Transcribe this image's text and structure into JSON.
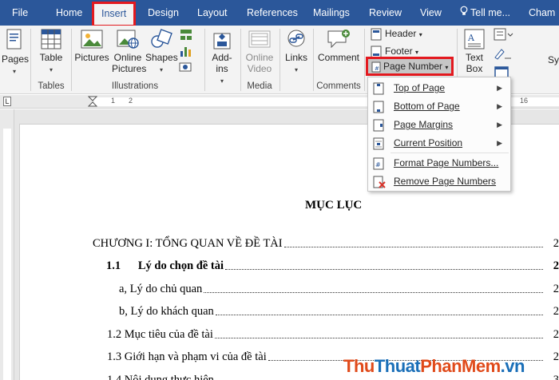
{
  "tabs": [
    {
      "label": "File"
    },
    {
      "label": "Home"
    },
    {
      "label": "Insert",
      "active": true
    },
    {
      "label": "Design"
    },
    {
      "label": "Layout"
    },
    {
      "label": "References"
    },
    {
      "label": "Mailings"
    },
    {
      "label": "Review"
    },
    {
      "label": "View"
    }
  ],
  "tell_me": "Tell me...",
  "user": "Cham",
  "ribbon": {
    "pages": "Pages",
    "table": "Table",
    "pictures": "Pictures",
    "online_pictures": "Online Pictures",
    "shapes": "Shapes",
    "addins": "Add-ins",
    "online_video": "Online Video",
    "links": "Links",
    "comment": "Comment",
    "header": "Header",
    "footer": "Footer",
    "page_number": "Page Number",
    "text_box": "Text Box",
    "sy": "Sy",
    "groups": {
      "tables": "Tables",
      "illustrations": "Illustrations",
      "media": "Media",
      "comments": "Comments"
    }
  },
  "ruler_numbers": [
    "1",
    "2",
    "16"
  ],
  "page_number_menu": [
    {
      "label": "Top of Page",
      "submenu": true,
      "icon": "page-top-icon"
    },
    {
      "label": "Bottom of Page",
      "submenu": true,
      "icon": "page-bottom-icon"
    },
    {
      "label": "Page Margins",
      "submenu": true,
      "icon": "page-margins-icon"
    },
    {
      "label": "Current Position",
      "submenu": true,
      "icon": "current-position-icon"
    },
    {
      "label": "Format Page Numbers...",
      "submenu": false,
      "icon": "format-page-numbers-icon"
    },
    {
      "label": "Remove Page Numbers",
      "submenu": false,
      "icon": "remove-page-numbers-icon"
    }
  ],
  "document": {
    "title": "MỤC LỤC",
    "toc": [
      {
        "text": "CHƯƠNG I: TỔNG QUAN VỀ ĐỀ TÀI",
        "page": "2",
        "bold": false
      },
      {
        "text": "1.1      Lý do chọn đề tài",
        "page": "2",
        "bold": true
      },
      {
        "text": "a, Lý do chủ quan",
        "page": "2",
        "bold": false
      },
      {
        "text": "b, Lý do khách quan",
        "page": "2",
        "bold": false
      },
      {
        "text": "1.2 Mục tiêu của đề tài",
        "page": "2",
        "bold": false
      },
      {
        "text": "1.3 Giới hạn và phạm vi của đề tài",
        "page": "2",
        "bold": false
      },
      {
        "text": "1.4 Nội dung thực hiện",
        "page": "3",
        "bold": false
      }
    ]
  },
  "watermark": {
    "part1": "Thu",
    "part2": "Thuat",
    "part3": "PhanMem",
    "part4": ".vn"
  }
}
